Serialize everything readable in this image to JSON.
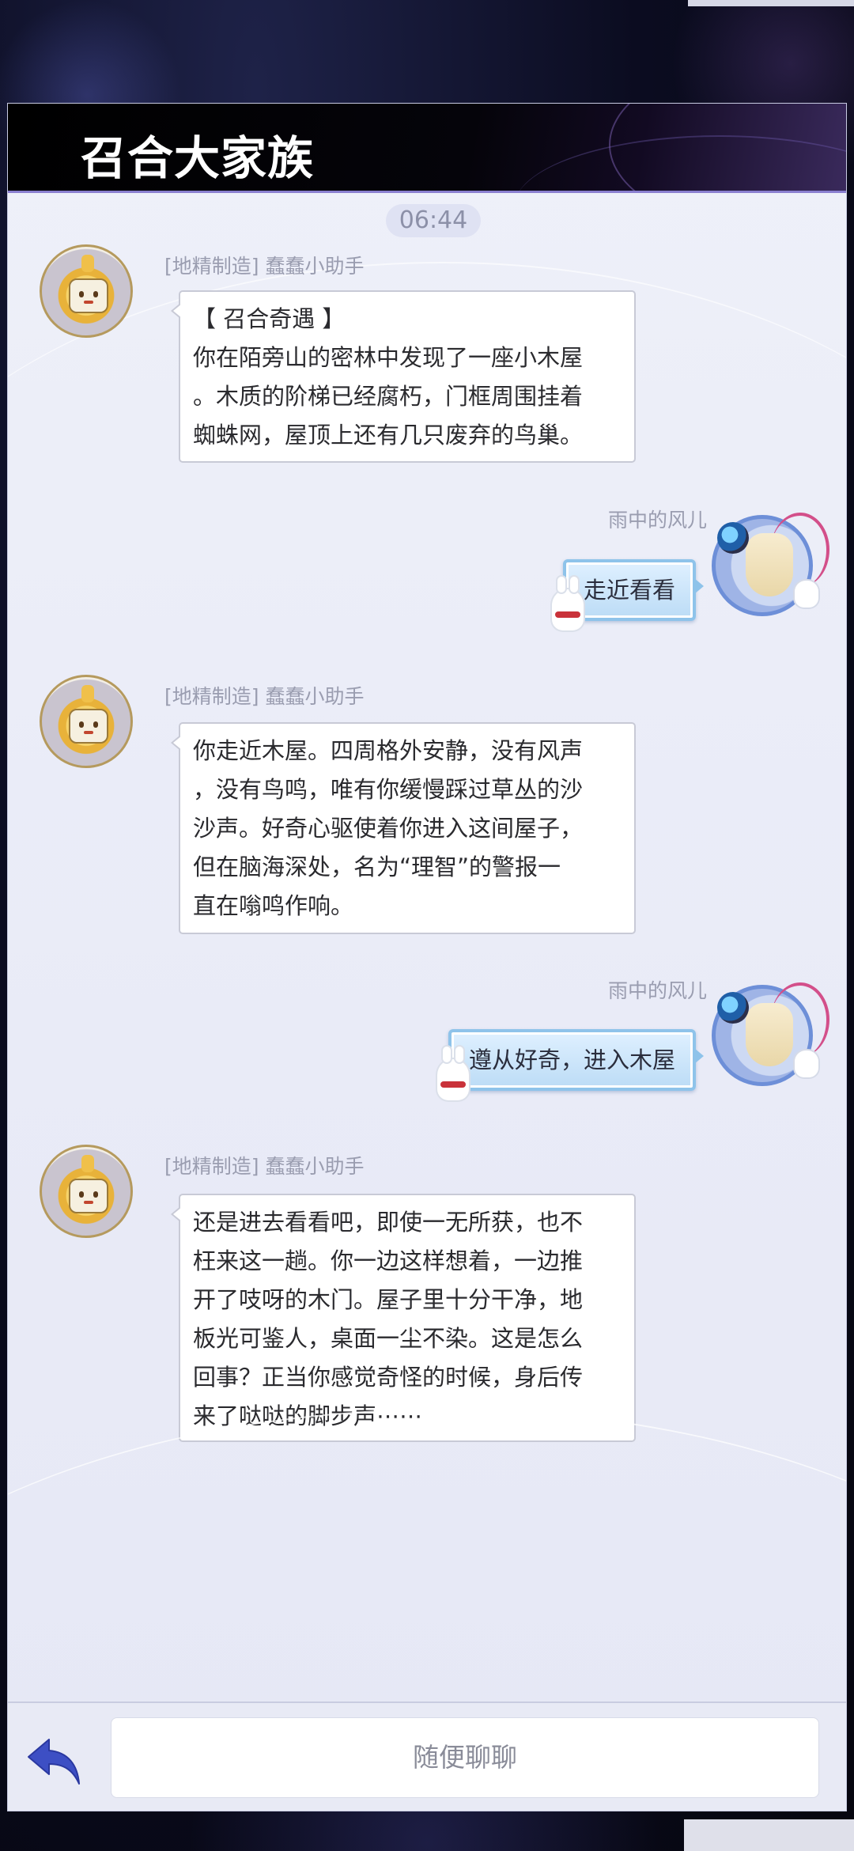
{
  "header": {
    "title": "召合大家族"
  },
  "chat": {
    "timestamp": "06:44",
    "messages": [
      {
        "sender": "[地精制造] 蠢蠢小助手",
        "side": "left",
        "lines": [
          "【 召合奇遇 】",
          "你在陌旁山的密林中发现了一座小木屋",
          "。木质的阶梯已经腐朽，门框周围挂着",
          "蜘蛛网，屋顶上还有几只废弃的鸟巢。"
        ]
      },
      {
        "sender": "雨中的风儿",
        "side": "right",
        "text": "走近看看"
      },
      {
        "sender": "[地精制造] 蠢蠢小助手",
        "side": "left",
        "lines": [
          "你走近木屋。四周格外安静，没有风声",
          "，没有鸟鸣，唯有你缓慢踩过草丛的沙",
          "沙声。好奇心驱使着你进入这间屋子，",
          "但在脑海深处，名为“理智”的警报一",
          "直在嗡鸣作响。"
        ]
      },
      {
        "sender": "雨中的风儿",
        "side": "right",
        "text": "遵从好奇，进入木屋"
      },
      {
        "sender": "[地精制造] 蠢蠢小助手",
        "side": "left",
        "lines": [
          "还是进去看看吧，即使一无所获，也不",
          "枉来这一趟。你一边这样想着，一边推",
          "开了吱呀的木门。屋子里十分干净，地",
          "板光可鉴人，桌面一尘不染。这是怎么",
          "回事？正当你感觉奇怪的时候，身后传",
          "来了哒哒的脚步声⋯⋯"
        ]
      }
    ]
  },
  "input": {
    "placeholder": "随便聊聊"
  },
  "icons": {
    "back": "back-arrow-icon",
    "bot_avatar": "robot-avatar",
    "user_avatar": "user-avatar"
  },
  "colors": {
    "back_icon": "#3d4fc4",
    "header_bg": "#000000",
    "panel_bg": "#eef0f9"
  }
}
